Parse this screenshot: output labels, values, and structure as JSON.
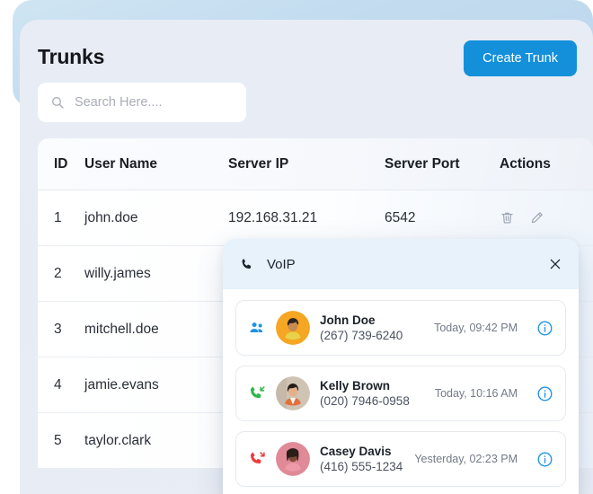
{
  "header": {
    "title": "Trunks",
    "create_button": "Create Trunk"
  },
  "search": {
    "placeholder": "Search Here....",
    "value": ""
  },
  "table": {
    "columns": [
      "ID",
      "User Name",
      "Server IP",
      "Server Port",
      "Actions"
    ],
    "rows": [
      {
        "id": "1",
        "user_name": "john.doe",
        "server_ip": "192.168.31.21",
        "server_port": "6542"
      },
      {
        "id": "2",
        "user_name": "willy.james",
        "server_ip": "",
        "server_port": ""
      },
      {
        "id": "3",
        "user_name": "mitchell.doe",
        "server_ip": "",
        "server_port": ""
      },
      {
        "id": "4",
        "user_name": "jamie.evans",
        "server_ip": "",
        "server_port": ""
      },
      {
        "id": "5",
        "user_name": "taylor.clark",
        "server_ip": "",
        "server_port": ""
      }
    ],
    "actions": {
      "delete_icon": "trash-icon",
      "edit_icon": "pencil-icon"
    }
  },
  "voip_panel": {
    "title": "VoIP",
    "header_icon": "phone-icon",
    "close_icon": "close-icon",
    "calls": [
      {
        "name": "John Doe",
        "number": "(267) 739-6240",
        "time": "Today, 09:42 PM",
        "type_icon": "group-call-icon",
        "type_color": "#1e93e6",
        "avatar_color": "#f5a623",
        "info_icon": "info-icon"
      },
      {
        "name": "Kelly Brown",
        "number": "(020) 7946-0958",
        "time": "Today, 10:16 AM",
        "type_icon": "incoming-call-icon",
        "type_color": "#2eb84b",
        "avatar_color": "#cfc3b4",
        "info_icon": "info-icon"
      },
      {
        "name": "Casey Davis",
        "number": "(416) 555-1234",
        "time": "Yesterday, 02:23 PM",
        "type_icon": "missed-call-icon",
        "type_color": "#ee3b3b",
        "avatar_color": "#e08a98",
        "info_icon": "info-icon"
      }
    ]
  },
  "colors": {
    "accent": "#1490db",
    "panel_bg": "#e8ecf4",
    "voip_header_bg": "#e7f2fa",
    "back_card": "#c3dcef"
  }
}
